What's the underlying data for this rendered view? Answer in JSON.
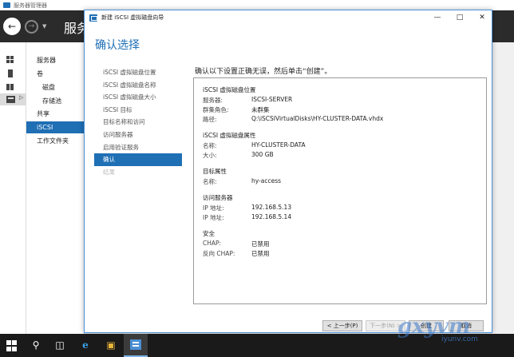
{
  "background_app": {
    "window_title": "服务器管理器",
    "header_title": "服务",
    "nav": {
      "items": [
        {
          "label": "服务器",
          "level": 0,
          "selected": false
        },
        {
          "label": "卷",
          "level": 0,
          "selected": false
        },
        {
          "label": "磁盘",
          "level": 1,
          "selected": false
        },
        {
          "label": "存储池",
          "level": 1,
          "selected": false
        },
        {
          "label": "共享",
          "level": 0,
          "selected": false
        },
        {
          "label": "iSCSI",
          "level": 0,
          "selected": true
        },
        {
          "label": "工作文件夹",
          "level": 0,
          "selected": false
        }
      ]
    }
  },
  "wizard": {
    "title": "新建 iSCSI 虚拟磁盘向导",
    "page_title": "确认选择",
    "steps": [
      {
        "label": "iSCSI 虚拟磁盘位置",
        "state": "normal"
      },
      {
        "label": "iSCSI 虚拟磁盘名称",
        "state": "normal"
      },
      {
        "label": "iSCSI 虚拟磁盘大小",
        "state": "normal"
      },
      {
        "label": "iSCSI 目标",
        "state": "normal"
      },
      {
        "label": "目标名称和访问",
        "state": "normal"
      },
      {
        "label": "访问服务器",
        "state": "normal"
      },
      {
        "label": "启用验证服务",
        "state": "normal"
      },
      {
        "label": "确认",
        "state": "selected"
      },
      {
        "label": "结果",
        "state": "disabled"
      }
    ],
    "instruction": "确认以下设置正确无误，然后单击“创建”。",
    "summary": {
      "disk_location": {
        "heading": "iSCSI 虚拟磁盘位置",
        "server_label": "服务器:",
        "server_value": "ISCSI-SERVER",
        "cluster_role_label": "群集角色:",
        "cluster_role_value": "未群集",
        "path_label": "路径:",
        "path_value": "Q:\\iSCSIVirtualDisks\\HY-CLUSTER-DATA.vhdx"
      },
      "disk_properties": {
        "heading": "iSCSI 虚拟磁盘属性",
        "name_label": "名称:",
        "name_value": "HY-CLUSTER-DATA",
        "size_label": "大小:",
        "size_value": "300 GB"
      },
      "target_properties": {
        "heading": "目标属性",
        "name_label": "名称:",
        "name_value": "hy-access"
      },
      "access_servers": {
        "heading": "访问服务器",
        "ip1_label": "IP 地址:",
        "ip1_value": "192.168.5.13",
        "ip2_label": "IP 地址:",
        "ip2_value": "192.168.5.14"
      },
      "security": {
        "heading": "安全",
        "chap_label": "CHAP:",
        "chap_value": "已禁用",
        "reverse_chap_label": "反向 CHAP:",
        "reverse_chap_value": "已禁用"
      }
    },
    "buttons": {
      "prev": "< 上一步(P)",
      "next": "下一步(N) >",
      "create": "创建",
      "cancel": "取消"
    }
  },
  "watermark": {
    "text": "gxyvm",
    "url": "iyunv.com"
  },
  "colors": {
    "accent": "#1f6fb5",
    "header_dark": "#2b2b2b",
    "taskbar": "#1a1a1a"
  }
}
